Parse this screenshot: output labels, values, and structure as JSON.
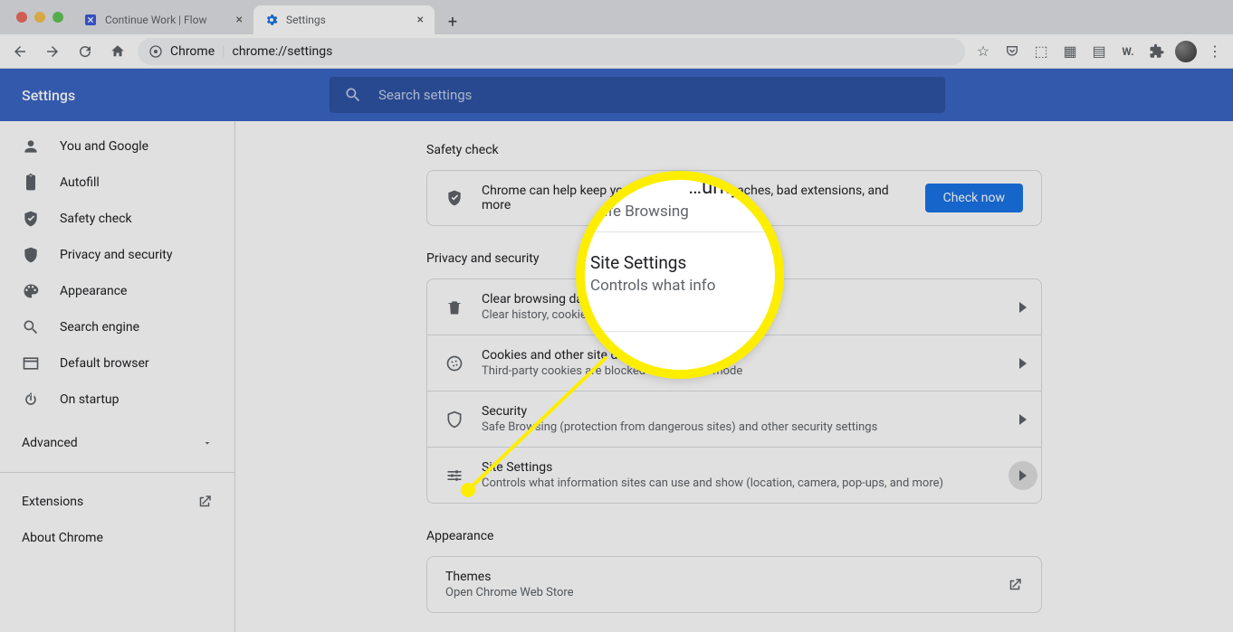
{
  "browser": {
    "tabs": [
      {
        "title": "Continue Work | Flow",
        "active": false
      },
      {
        "title": "Settings",
        "active": true
      }
    ],
    "omnibox": {
      "label": "Chrome",
      "url": "chrome://settings"
    }
  },
  "header": {
    "title": "Settings",
    "search_placeholder": "Search settings"
  },
  "sidebar": {
    "items": [
      {
        "label": "You and Google",
        "icon": "person-icon"
      },
      {
        "label": "Autofill",
        "icon": "clipboard-icon"
      },
      {
        "label": "Safety check",
        "icon": "shield-check-icon"
      },
      {
        "label": "Privacy and security",
        "icon": "shield-icon"
      },
      {
        "label": "Appearance",
        "icon": "palette-icon"
      },
      {
        "label": "Search engine",
        "icon": "search-icon"
      },
      {
        "label": "Default browser",
        "icon": "browser-icon"
      },
      {
        "label": "On startup",
        "icon": "power-icon"
      }
    ],
    "advanced": "Advanced",
    "links": [
      {
        "label": "Extensions",
        "external": true
      },
      {
        "label": "About Chrome",
        "external": false
      }
    ]
  },
  "sections": {
    "safety": {
      "heading": "Safety check",
      "text": "Chrome can help keep you safe from data breaches, bad extensions, and more",
      "button": "Check now"
    },
    "privacy": {
      "heading": "Privacy and security",
      "rows": [
        {
          "title": "Clear browsing data",
          "sub": "Clear history, cookies, cache, and more",
          "icon": "trash-icon"
        },
        {
          "title": "Cookies and other site data",
          "sub": "Third-party cookies are blocked in Incognito mode",
          "icon": "cookie-icon"
        },
        {
          "title": "Security",
          "sub": "Safe Browsing (protection from dangerous sites) and other security settings",
          "icon": "shield-icon"
        },
        {
          "title": "Site Settings",
          "sub": "Controls what information sites can use and show (location, camera, pop-ups, and more)",
          "icon": "tune-icon",
          "highlight": true
        }
      ]
    },
    "appearance": {
      "heading": "Appearance",
      "themes": {
        "title": "Themes",
        "sub": "Open Chrome Web Store"
      }
    }
  },
  "callout": {
    "top_title": "…urity",
    "top_sub": "Safe Browsing",
    "main_title": "Site Settings",
    "main_sub": "Controls what info"
  }
}
